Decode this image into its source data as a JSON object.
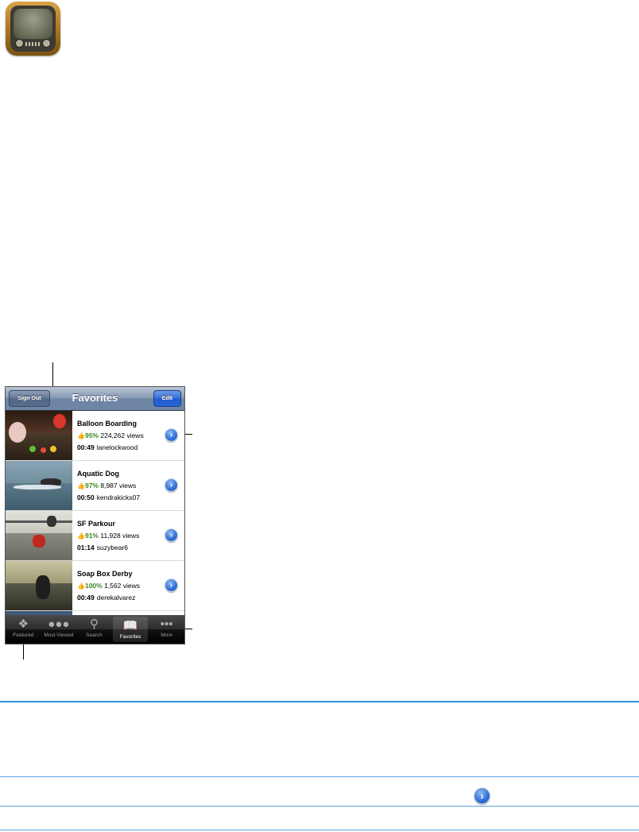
{
  "app_icon": {
    "name": "youtube-app-icon"
  },
  "navbar": {
    "title": "Favorites",
    "left_button": "Sign Out",
    "right_button": "Edit"
  },
  "videos": [
    {
      "title": "Balloon Boarding",
      "rating": "95%",
      "views": "224,262 views",
      "duration": "00:49",
      "user": "lanelockwood"
    },
    {
      "title": "Aquatic Dog",
      "rating": "97%",
      "views": "8,987 views",
      "duration": "00:50",
      "user": "kendrakicks07"
    },
    {
      "title": "SF Parkour",
      "rating": "91%",
      "views": "11,928 views",
      "duration": "01:14",
      "user": "suzybear6"
    },
    {
      "title": "Soap Box Derby",
      "rating": "100%",
      "views": "1,562 views",
      "duration": "00:49",
      "user": "derekalvarez"
    }
  ],
  "tabbar": {
    "tabs": [
      {
        "label": "Featured",
        "icon": "featured-icon"
      },
      {
        "label": "Most Viewed",
        "icon": "most-viewed-icon"
      },
      {
        "label": "Search",
        "icon": "search-icon"
      },
      {
        "label": "Favorites",
        "icon": "favorites-icon"
      },
      {
        "label": "More",
        "icon": "more-icon"
      }
    ],
    "active": "Favorites"
  },
  "glyphs": {
    "chevron": "›",
    "thumb_up": "👍"
  },
  "colors": {
    "accent_blue": "#3a8fd6",
    "rating_green": "#3a8a1c"
  }
}
